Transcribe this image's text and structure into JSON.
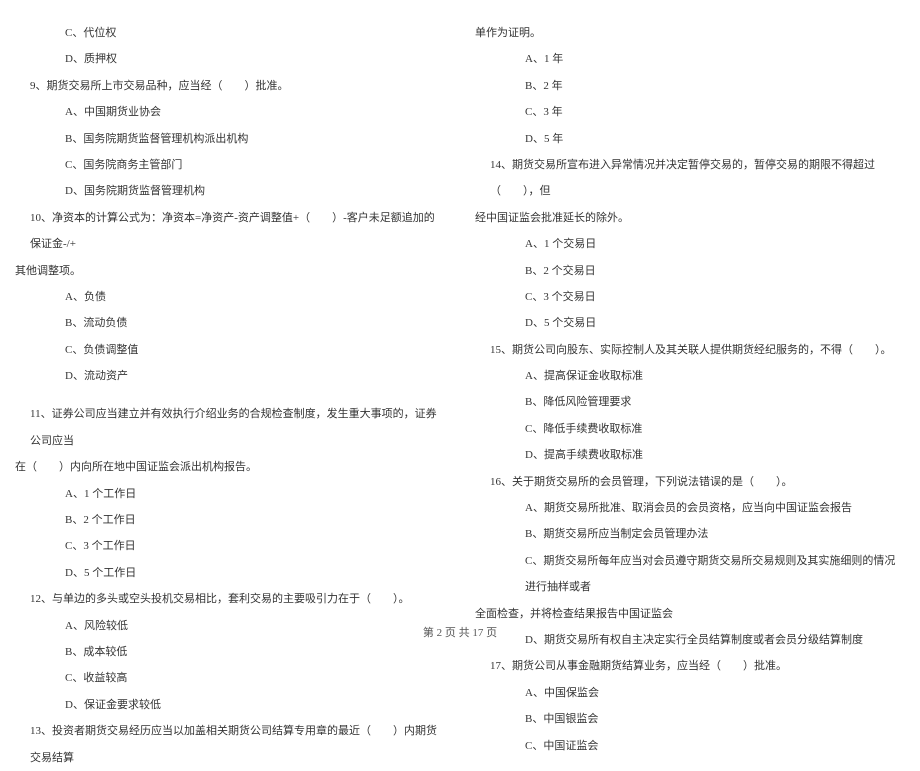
{
  "left": {
    "opt8c": "C、代位权",
    "opt8d": "D、质押权",
    "q9": "9、期货交易所上市交易品种，应当经（　　）批准。",
    "opt9a": "A、中国期货业协会",
    "opt9b": "B、国务院期货监督管理机构派出机构",
    "opt9c": "C、国务院商务主管部门",
    "opt9d": "D、国务院期货监督管理机构",
    "q10a": "10、净资本的计算公式为：净资本=净资产-资产调整值+（　　）-客户未足额追加的保证金-/+",
    "q10b": "其他调整项。",
    "opt10a": "A、负债",
    "opt10b": "B、流动负债",
    "opt10c": "C、负债调整值",
    "opt10d": "D、流动资产",
    "q11a": "11、证券公司应当建立并有效执行介绍业务的合规检查制度，发生重大事项的，证券公司应当",
    "q11b": "在（　　）内向所在地中国证监会派出机构报告。",
    "opt11a": "A、1 个工作日",
    "opt11b": "B、2 个工作日",
    "opt11c": "C、3 个工作日",
    "opt11d": "D、5 个工作日",
    "q12": "12、与单边的多头或空头投机交易相比，套利交易的主要吸引力在于（　　）。",
    "opt12a": "A、风险较低",
    "opt12b": "B、成本较低",
    "opt12c": "C、收益较高",
    "opt12d": "D、保证金要求较低",
    "q13": "13、投资者期货交易经历应当以加盖相关期货公司结算专用章的最近（　　）内期货交易结算"
  },
  "right": {
    "q13cont": "单作为证明。",
    "opt13a": "A、1 年",
    "opt13b": "B、2 年",
    "opt13c": "C、3 年",
    "opt13d": "D、5 年",
    "q14a": "14、期货交易所宣布进入异常情况并决定暂停交易的，暂停交易的期限不得超过（　　），但",
    "q14b": "经中国证监会批准延长的除外。",
    "opt14a": "A、1 个交易日",
    "opt14b": "B、2 个交易日",
    "opt14c": "C、3 个交易日",
    "opt14d": "D、5 个交易日",
    "q15": "15、期货公司向股东、实际控制人及其关联人提供期货经纪服务的，不得（　　）。",
    "opt15a": "A、提高保证金收取标准",
    "opt15b": "B、降低风险管理要求",
    "opt15c": "C、降低手续费收取标准",
    "opt15d": "D、提高手续费收取标准",
    "q16": "16、关于期货交易所的会员管理，下列说法错误的是（　　）。",
    "opt16a": "A、期货交易所批准、取消会员的会员资格，应当向中国证监会报告",
    "opt16b": "B、期货交易所应当制定会员管理办法",
    "opt16ca": "C、期货交易所每年应当对会员遵守期货交易所交易规则及其实施细则的情况进行抽样或者",
    "opt16cb": "全面检查，并将检查结果报告中国证监会",
    "opt16d": "D、期货交易所有权自主决定实行全员结算制度或者会员分级结算制度",
    "q17": "17、期货公司从事金融期货结算业务，应当经（　　）批准。",
    "opt17a": "A、中国保监会",
    "opt17b": "B、中国银监会",
    "opt17c": "C、中国证监会"
  },
  "footer": "第 2 页 共 17 页"
}
